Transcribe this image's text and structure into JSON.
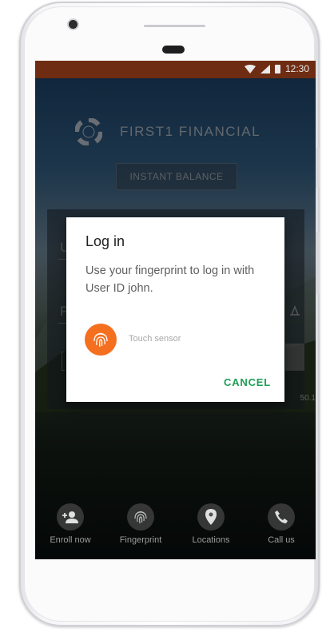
{
  "status_bar": {
    "time": "12:30",
    "background": "#6e2c12"
  },
  "app": {
    "brand_name": "FIRST1 FINANCIAL",
    "instant_balance_label": "INSTANT BALANCE",
    "username_placeholder_letter": "U",
    "password_placeholder_letter": "P",
    "version_text": "50.1"
  },
  "dialog": {
    "title": "Log in",
    "body": "Use your fingerprint to log in with User ID john.",
    "sensor_label": "Touch sensor",
    "cancel_label": "CANCEL",
    "accent_orange": "#f4701f",
    "accent_green": "#1e9e57"
  },
  "bottom_nav": {
    "items": [
      {
        "label": "Enroll now",
        "icon": "person-add-icon"
      },
      {
        "label": "Fingerprint",
        "icon": "fingerprint-icon"
      },
      {
        "label": "Locations",
        "icon": "location-pin-icon"
      },
      {
        "label": "Call us",
        "icon": "phone-icon"
      }
    ]
  }
}
